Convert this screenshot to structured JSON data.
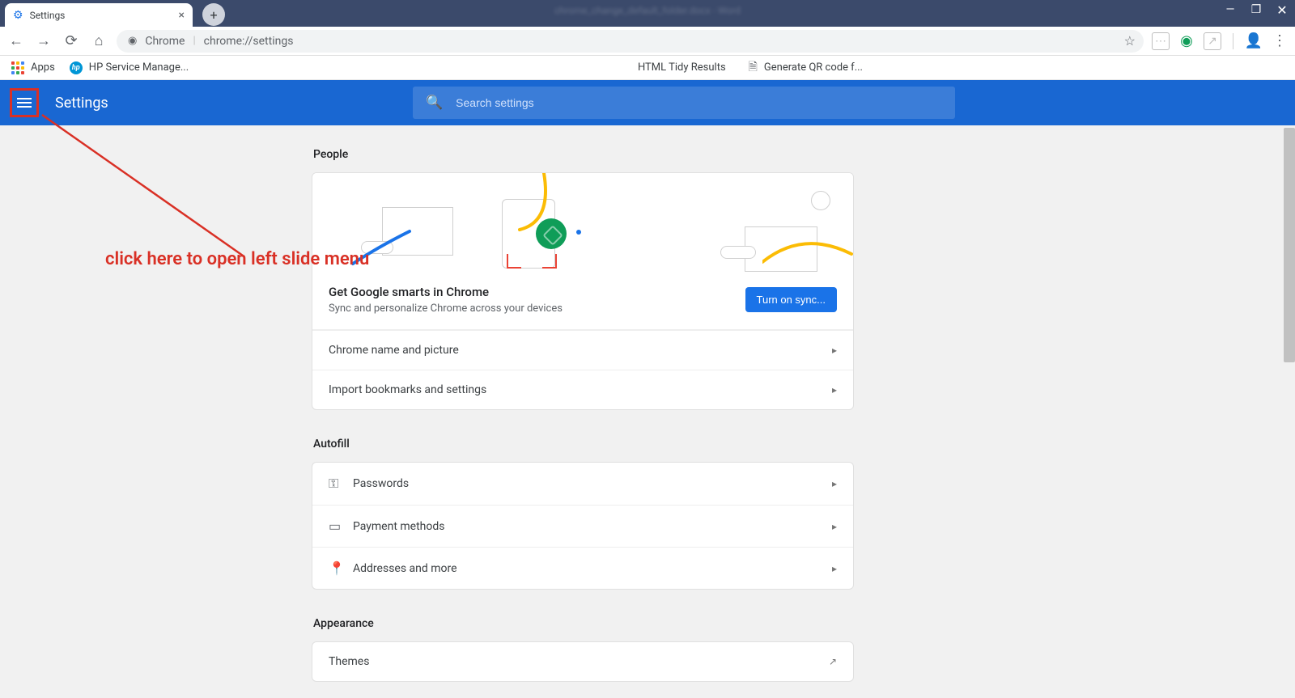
{
  "window": {
    "tab_title": "Settings",
    "title_blur": "chrome_change_default_folder.docx - Word"
  },
  "addressbar": {
    "origin_label": "Chrome",
    "url": "chrome://settings"
  },
  "bookmarks": {
    "apps": "Apps",
    "hp": "HP Service Manage...",
    "tidy": "HTML Tidy Results",
    "qr": "Generate QR code f..."
  },
  "header": {
    "title": "Settings",
    "search_placeholder": "Search settings"
  },
  "annotation": {
    "text": "click here to open left slide menu"
  },
  "sections": {
    "people": {
      "title": "People",
      "sync_title": "Get Google smarts in Chrome",
      "sync_sub": "Sync and personalize Chrome across your devices",
      "sync_button": "Turn on sync...",
      "row1": "Chrome name and picture",
      "row2": "Import bookmarks and settings"
    },
    "autofill": {
      "title": "Autofill",
      "passwords": "Passwords",
      "payment": "Payment methods",
      "addresses": "Addresses and more"
    },
    "appearance": {
      "title": "Appearance",
      "themes": "Themes"
    }
  }
}
